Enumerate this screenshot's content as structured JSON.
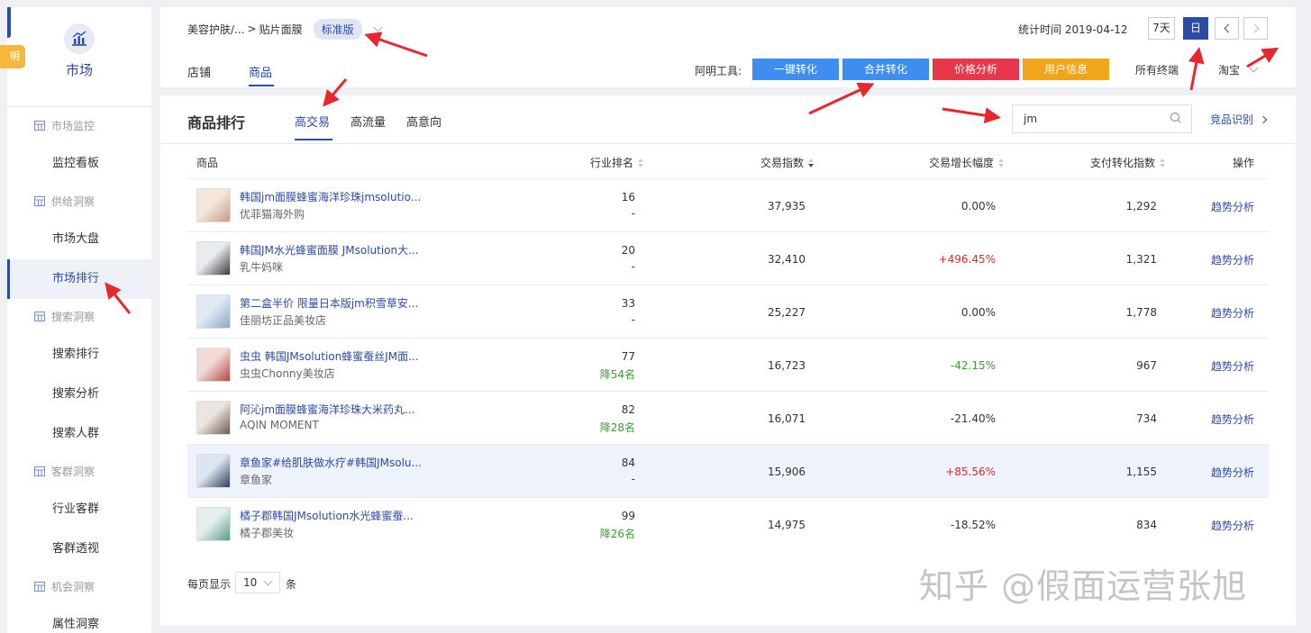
{
  "sidebar": {
    "brand_label": "市场",
    "badge_text": "明",
    "sections": [
      {
        "label": "市场监控",
        "items": [
          "监控看板"
        ]
      },
      {
        "label": "供给洞察",
        "items": [
          "市场大盘",
          "市场排行"
        ]
      },
      {
        "label": "搜索洞察",
        "items": [
          "搜索排行",
          "搜索分析",
          "搜索人群"
        ]
      },
      {
        "label": "客群洞察",
        "items": [
          "行业客群",
          "客群透视"
        ]
      },
      {
        "label": "机会洞察",
        "items": [
          "属性洞察"
        ]
      }
    ],
    "active_item": "市场排行"
  },
  "header": {
    "breadcrumb": [
      "美容护肤/...",
      "贴片面膜"
    ],
    "breadcrumb_sep": ">",
    "version_badge": "标准版",
    "stat_time": "统计时间 2019-04-12",
    "range_7d": "7天",
    "range_day": "日",
    "tabs": [
      "店铺",
      "商品"
    ],
    "active_tab": "商品",
    "tools_label": "阿明工具:",
    "tools": [
      {
        "label": "一键转化",
        "color": "#3d8ef0"
      },
      {
        "label": "合并转化",
        "color": "#3d8ef0"
      },
      {
        "label": "价格分析",
        "color": "#e8364a"
      },
      {
        "label": "用户信息",
        "color": "#f0a51a"
      }
    ],
    "terminal_select": "所有终端",
    "platform_select": "淘宝"
  },
  "main": {
    "title": "商品排行",
    "subtabs": [
      "高交易",
      "高流量",
      "高意向"
    ],
    "active_subtab": "高交易",
    "search_value": "jm",
    "competitor_link": "竞品识别",
    "columns": [
      "商品",
      "行业排名",
      "交易指数",
      "交易增长幅度",
      "支付转化指数",
      "操作"
    ],
    "rows": [
      {
        "title": "韩国jm面膜蜂蜜海洋珍珠jmsolutio...",
        "shop": "优菲猫海外购",
        "rank": "16",
        "rank_change": "-",
        "trade": "37,935",
        "growth": "0.00%",
        "pay": "1,292",
        "op": "趋势分析"
      },
      {
        "title": "韩国JM水光蜂蜜面膜 JMsolution大...",
        "shop": "乳牛妈咪",
        "rank": "20",
        "rank_change": "-",
        "trade": "32,410",
        "growth": "+496.45%",
        "pay": "1,321",
        "op": "趋势分析"
      },
      {
        "title": "第二盒半价 限量日本版jm积雪草安...",
        "shop": "佳丽坊正品美妆店",
        "rank": "33",
        "rank_change": "-",
        "trade": "25,227",
        "growth": "0.00%",
        "pay": "1,778",
        "op": "趋势分析"
      },
      {
        "title": "虫虫 韩国JMsolution蜂蜜蚕丝JM面...",
        "shop": "虫虫Chonny美妆店",
        "rank": "77",
        "rank_change": "降54名",
        "trade": "16,723",
        "growth": "-42.15%",
        "pay": "967",
        "op": "趋势分析"
      },
      {
        "title": "阿沁jm面膜蜂蜜海洋珍珠大米药丸...",
        "shop": "AQIN MOMENT",
        "rank": "82",
        "rank_change": "降28名",
        "trade": "16,071",
        "growth": "-21.40%",
        "pay": "734",
        "op": "趋势分析"
      },
      {
        "title": "章鱼家#给肌肤做水疗#韩国JMsolu...",
        "shop": "章鱼家",
        "rank": "84",
        "rank_change": "-",
        "trade": "15,906",
        "growth": "+85.56%",
        "pay": "1,155",
        "op": "趋势分析"
      },
      {
        "title": "橘子郡韩国JMsolution水光蜂蜜蚕...",
        "shop": "橘子郡美妆",
        "rank": "99",
        "rank_change": "降26名",
        "trade": "14,975",
        "growth": "-18.52%",
        "pay": "834",
        "op": "趋势分析"
      }
    ],
    "page_size_label": "每页显示",
    "page_size": "10",
    "page_size_unit": "条"
  },
  "watermark": "知乎 @假面运营张旭",
  "colors": {
    "accent": "#2c4aa8",
    "annotation_arrow": "#e8262b",
    "up": "#e02b2b",
    "down": "#3d9b35"
  }
}
